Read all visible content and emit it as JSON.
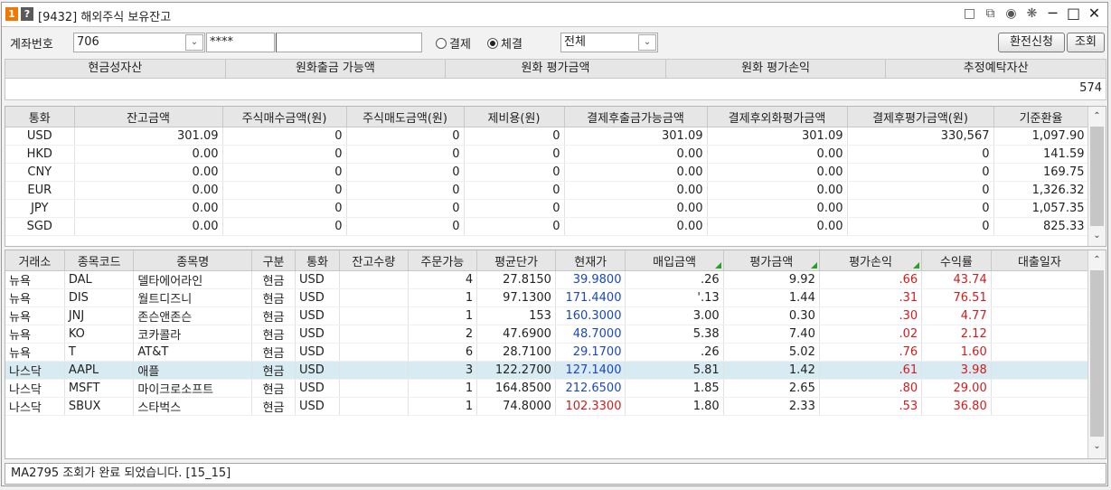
{
  "window": {
    "number_badge": "1",
    "help_badge": "?",
    "title": "[9432] 해외주식 보유잔고",
    "icons": [
      "memo-icon",
      "copy-icon",
      "camera-icon",
      "settings-icon",
      "minimize-icon",
      "maximize-icon",
      "close-icon"
    ]
  },
  "query": {
    "account_label": "계좌번호",
    "account_value": "706",
    "password_value": "****",
    "radio_settle": "결제",
    "radio_trade": "체결",
    "selected_radio": "체결",
    "filter_value": "전체",
    "exchange_button": "환전신청",
    "search_button": "조회"
  },
  "summary": {
    "headers": [
      "현금성자산",
      "원화출금 가능액",
      "원화 평가금액",
      "원화 평가손익",
      "추정예탁자산"
    ],
    "value_tail": "574"
  },
  "currency_grid": {
    "headers": [
      "통화",
      "잔고금액",
      "주식매수금액(원)",
      "주식매도금액(원)",
      "제비용(원)",
      "결제후출금가능금액",
      "결제후외화평가금액",
      "결제후평가금액(원)",
      "기준환율"
    ],
    "rows": [
      [
        "USD",
        "301.09",
        "0",
        "0",
        "0",
        "301.09",
        "301.09",
        "330,567",
        "1,097.90"
      ],
      [
        "HKD",
        "0.00",
        "0",
        "0",
        "0",
        "0.00",
        "0.00",
        "0",
        "141.59"
      ],
      [
        "CNY",
        "0.00",
        "0",
        "0",
        "0",
        "0.00",
        "0.00",
        "0",
        "169.75"
      ],
      [
        "EUR",
        "0.00",
        "0",
        "0",
        "0",
        "0.00",
        "0.00",
        "0",
        "1,326.32"
      ],
      [
        "JPY",
        "0.00",
        "0",
        "0",
        "0",
        "0.00",
        "0.00",
        "0",
        "1,057.35"
      ],
      [
        "SGD",
        "0.00",
        "0",
        "0",
        "0",
        "0.00",
        "0.00",
        "0",
        "825.33"
      ]
    ]
  },
  "holdings_grid": {
    "headers": [
      "거래소",
      "종목코드",
      "종목명",
      "구분",
      "통화",
      "잔고수량",
      "주문가능",
      "평균단가",
      "현재가",
      "매입금액",
      "평가금액",
      "평가손익",
      "수익률",
      "대출일자"
    ],
    "rows": [
      {
        "exchange": "뉴욕",
        "code": "DAL",
        "name": "델타에어라인",
        "type": "현금",
        "ccy": "USD",
        "qty": "",
        "orderable": "4",
        "avg": "27.8150",
        "cur": "39.9800",
        "cur_color": "blue",
        "buy": ".26",
        "eval": "9.92",
        "pl": ".66",
        "rate": "43.74"
      },
      {
        "exchange": "뉴욕",
        "code": "DIS",
        "name": "월트디즈니",
        "type": "현금",
        "ccy": "USD",
        "qty": "",
        "orderable": "1",
        "avg": "97.1300",
        "cur": "171.4400",
        "cur_color": "blue",
        "buy": "'.13",
        "eval": "1.44",
        "pl": ".31",
        "rate": "76.51"
      },
      {
        "exchange": "뉴욕",
        "code": "JNJ",
        "name": "존슨앤존슨",
        "type": "현금",
        "ccy": "USD",
        "qty": "",
        "orderable": "1",
        "avg": "153",
        "cur": "160.3000",
        "cur_color": "blue",
        "buy": "3.00",
        "eval": "0.30",
        "pl": ".30",
        "rate": "4.77"
      },
      {
        "exchange": "뉴욕",
        "code": "KO",
        "name": "코카콜라",
        "type": "현금",
        "ccy": "USD",
        "qty": "",
        "orderable": "2",
        "avg": "47.6900",
        "cur": "48.7000",
        "cur_color": "blue",
        "buy": "5.38",
        "eval": "7.40",
        "pl": ".02",
        "rate": "2.12"
      },
      {
        "exchange": "뉴욕",
        "code": "T",
        "name": "AT&T",
        "type": "현금",
        "ccy": "USD",
        "qty": "",
        "orderable": "6",
        "avg": "28.7100",
        "cur": "29.1700",
        "cur_color": "blue",
        "buy": ".26",
        "eval": "5.02",
        "pl": ".76",
        "rate": "1.60"
      },
      {
        "exchange": "나스닥",
        "code": "AAPL",
        "name": "애플",
        "type": "현금",
        "ccy": "USD",
        "qty": "",
        "orderable": "3",
        "avg": "122.2700",
        "cur": "127.1400",
        "cur_color": "blue",
        "buy": "5.81",
        "eval": "1.42",
        "pl": ".61",
        "rate": "3.98"
      },
      {
        "exchange": "나스닥",
        "code": "MSFT",
        "name": "마이크로소프트",
        "type": "현금",
        "ccy": "USD",
        "qty": "",
        "orderable": "1",
        "avg": "164.8500",
        "cur": "212.6500",
        "cur_color": "blue",
        "buy": "1.85",
        "eval": "2.65",
        "pl": ".80",
        "rate": "29.00"
      },
      {
        "exchange": "나스닥",
        "code": "SBUX",
        "name": "스타벅스",
        "type": "현금",
        "ccy": "USD",
        "qty": "",
        "orderable": "1",
        "avg": "74.8000",
        "cur": "102.3300",
        "cur_color": "red",
        "buy": "1.80",
        "eval": "2.33",
        "pl": ".53",
        "rate": "36.80"
      }
    ],
    "selected_row": 5
  },
  "status_bar": {
    "message": "MA2795 조회가 완료 되었습니다. [15_15]"
  },
  "colors": {
    "up_blue": "#1a46c8",
    "down_red": "#d21c1c",
    "selected_row": "#d8eaf2",
    "badge_orange": "#f07800"
  }
}
